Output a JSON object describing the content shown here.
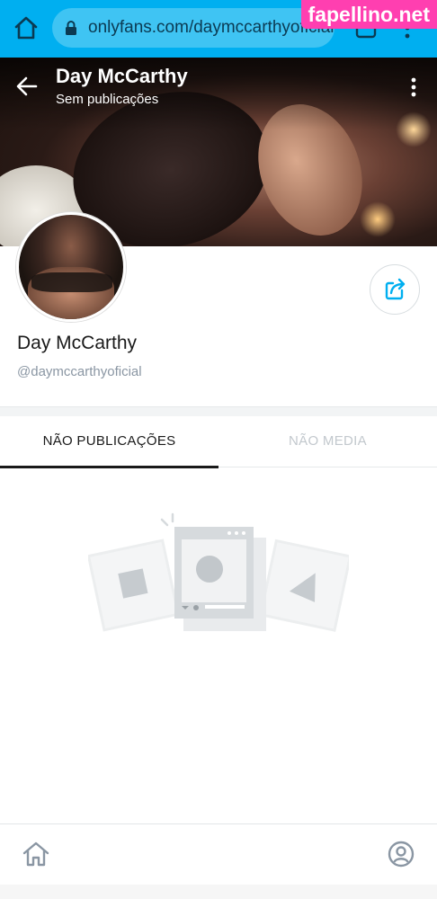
{
  "browser": {
    "url": "onlyfans.com/daymccarthyoficial",
    "watermark": "fapellino.net"
  },
  "header": {
    "title": "Day McCarthy",
    "subtitle": "Sem publicações"
  },
  "profile": {
    "name": "Day McCarthy",
    "handle": "@daymccarthyoficial"
  },
  "tabs": [
    {
      "label": "NÃO PUBLICAÇÕES",
      "active": true
    },
    {
      "label": "NÃO MEDIA",
      "active": false
    }
  ],
  "icons": {
    "browser_home": "home-icon",
    "lock": "lock-icon",
    "back": "arrow-left-icon",
    "more": "more-vertical-icon",
    "share": "share-icon",
    "empty": "empty-media-illustration",
    "nav_home": "home-icon",
    "nav_profile": "profile-icon"
  },
  "colors": {
    "brand": "#00aff0",
    "watermark": "#ff3fb0",
    "muted": "#8a96a3",
    "inactive_tab": "#c2c8cd"
  }
}
